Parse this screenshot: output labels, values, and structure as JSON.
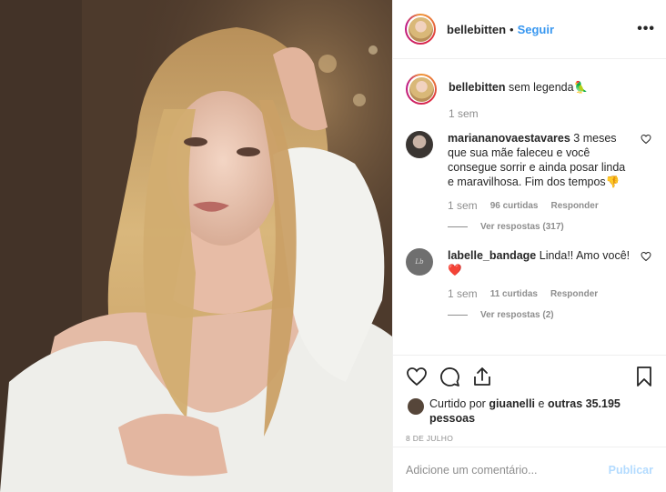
{
  "header": {
    "username": "bellebitten",
    "separator": "•",
    "follow_label": "Seguir",
    "more_icon": "more-icon",
    "more_label": "•••"
  },
  "caption": {
    "username": "bellebitten",
    "text": "sem legenda",
    "emoji": "🦜",
    "time": "1 sem"
  },
  "comments": [
    {
      "username": "mariananovaestavares",
      "text": "3 meses que sua mãe faleceu e você consegue sorrir e ainda posar linda e maravilhosa. Fim dos tempos",
      "emoji": "👎",
      "time": "1 sem",
      "likes": "96 curtidas",
      "reply_label": "Responder",
      "view_replies": "Ver respostas (317)"
    },
    {
      "username": "labelle_bandage",
      "text": "Linda!! Amo você!",
      "emoji": "❤️",
      "time": "1 sem",
      "likes": "11 curtidas",
      "reply_label": "Responder",
      "view_replies": "Ver respostas (2)"
    }
  ],
  "likes": {
    "prefix": "Curtido por",
    "user": "giuanelli",
    "connector": "e",
    "others": "outras 35.195 pessoas"
  },
  "date": "8 DE JULHO",
  "add_comment": {
    "placeholder": "Adicione um comentário...",
    "publish_label": "Publicar"
  },
  "colors": {
    "accent": "#3897f0",
    "publish_disabled": "#b3dbff",
    "secondary_text": "#8e8e8e"
  }
}
